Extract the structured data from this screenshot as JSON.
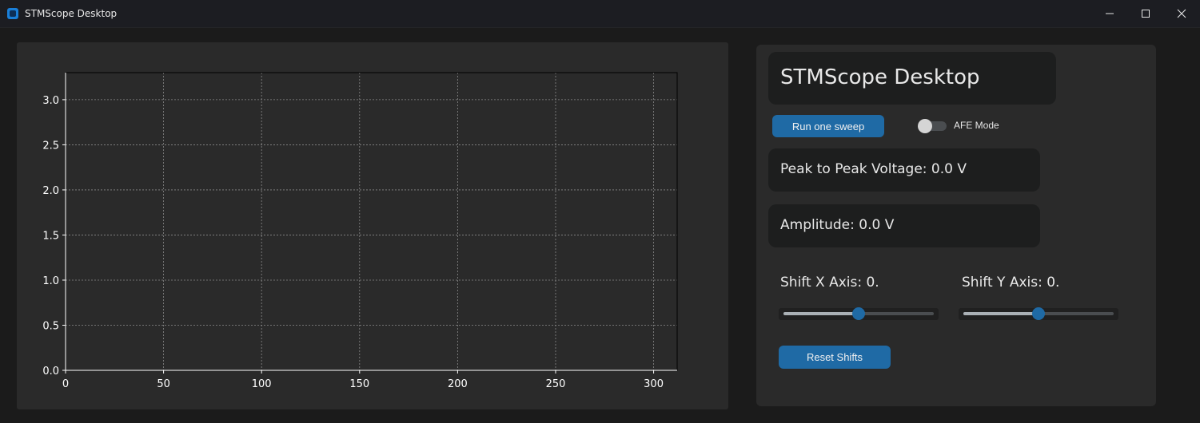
{
  "window": {
    "title": "STMScope Desktop",
    "controls": [
      "minimize-icon",
      "maximize-icon",
      "close-icon"
    ]
  },
  "controls": {
    "app_title": "STMScope Desktop",
    "sweep_button": "Run one sweep",
    "afe_label": "AFE Mode",
    "afe_on": false,
    "peak_to_peak": "Peak to Peak Voltage: 0.0 V",
    "amplitude": "Amplitude: 0.0 V",
    "shift_x_label": "Shift X Axis: 0.",
    "shift_y_label": "Shift Y Axis: 0.",
    "shift_x_value": 0.5,
    "shift_y_value": 0.5,
    "reset_button": "Reset Shifts"
  },
  "colors": {
    "accent": "#1f6aa5",
    "panel": "#2a2a2a",
    "background": "#1b1b1b"
  },
  "chart_data": {
    "type": "line",
    "title": "",
    "xlabel": "",
    "ylabel": "",
    "xlim": [
      0,
      312
    ],
    "ylim": [
      0,
      3.3
    ],
    "x_ticks": [
      0,
      50,
      100,
      150,
      200,
      250,
      300
    ],
    "y_ticks": [
      0.0,
      0.5,
      1.0,
      1.5,
      2.0,
      2.5,
      3.0
    ],
    "x_tick_labels": [
      "0",
      "50",
      "100",
      "150",
      "200",
      "250",
      "300"
    ],
    "y_tick_labels": [
      "0.0",
      "0.5",
      "1.0",
      "1.5",
      "2.0",
      "2.5",
      "3.0"
    ],
    "grid": true,
    "series": []
  }
}
